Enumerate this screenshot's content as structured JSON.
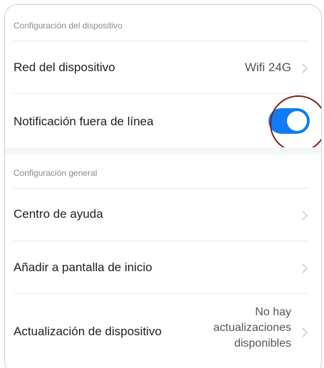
{
  "sections": {
    "device": {
      "header": "Configuración del dispositivo",
      "network": {
        "label": "Red del dispositivo",
        "value": "Wifi  24G"
      },
      "offline_notification": {
        "label": "Notificación fuera de línea",
        "enabled": true
      }
    },
    "general": {
      "header": "Configuración general",
      "help": {
        "label": "Centro de ayuda"
      },
      "home_screen": {
        "label": "Añadir a pantalla de inicio"
      },
      "update": {
        "label": "Actualización de dispositivo",
        "value_line1": "No hay",
        "value_line2": "actualizaciones",
        "value_line3": "disponibles"
      }
    }
  },
  "colors": {
    "toggle_on": "#0f7cf5",
    "highlight_ring": "#7a2020",
    "section_gap": "#f5f6f8"
  },
  "icons": {
    "chevron": "chevron-right-icon"
  }
}
